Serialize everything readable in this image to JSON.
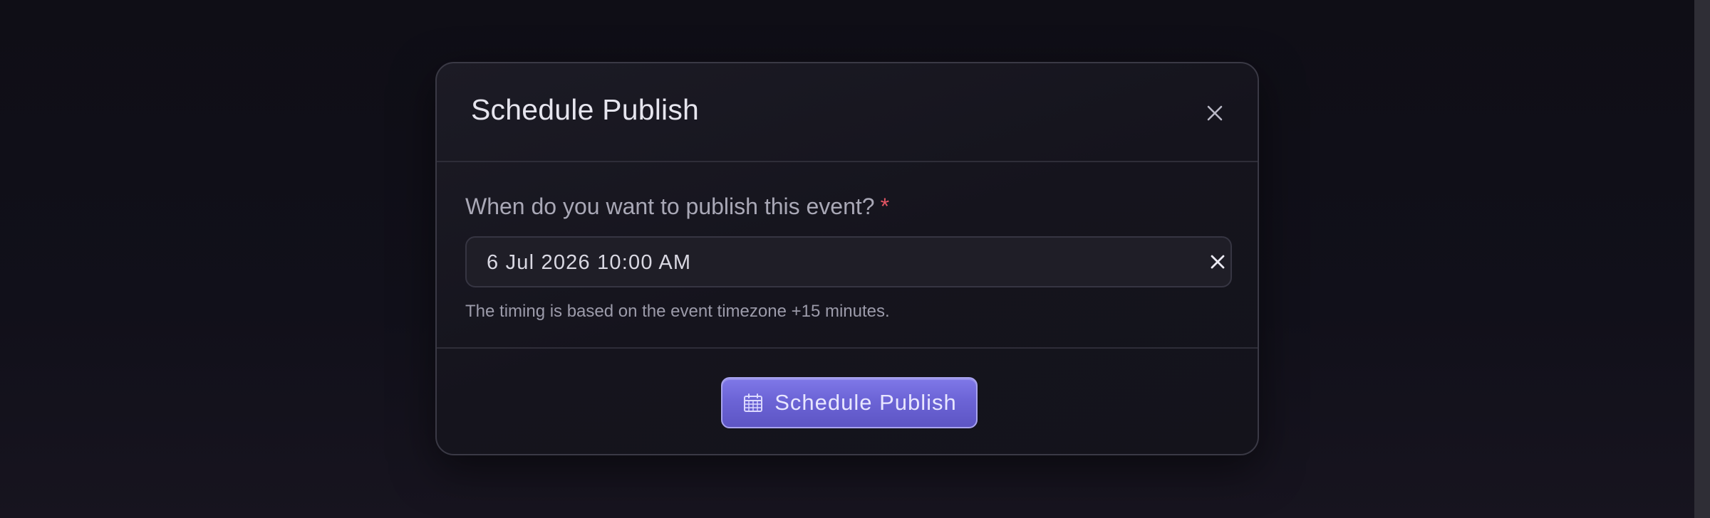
{
  "modal": {
    "title": "Schedule Publish",
    "close_icon": "close-icon",
    "field": {
      "label": "When do you want to publish this event?",
      "required_marker": "*",
      "value": "6 Jul 2026 10:00 AM",
      "clear_icon": "clear-icon",
      "helper": "The timing is based on the event timezone +15 minutes."
    },
    "submit": {
      "label": "Schedule Publish",
      "icon": "calendar-icon"
    }
  },
  "colors": {
    "accent": "#6c64d6",
    "required": "#e25563",
    "background": "#0f0e16"
  }
}
